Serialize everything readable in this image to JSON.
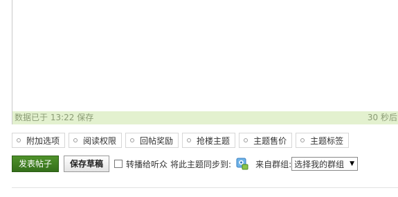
{
  "editor": {
    "status_saved": "数据已于 13:22 保存",
    "status_countdown": "30 秒后"
  },
  "options": [
    {
      "label": "附加选项"
    },
    {
      "label": "阅读权限"
    },
    {
      "label": "回帖奖励"
    },
    {
      "label": "抢楼主题"
    },
    {
      "label": "主题售价"
    },
    {
      "label": "主题标签"
    }
  ],
  "actions": {
    "publish_label": "发表帖子",
    "draft_label": "保存草稿",
    "forward_label": "转播给听众",
    "sync_label": "将此主题同步到:",
    "group_from_label": "来自群组:",
    "group_select_value": "选择我的群组",
    "forward_checked": false
  },
  "colors": {
    "status_bar_bg": "#e3f1cf",
    "publish_button_bg": "#3b7a1f"
  },
  "icons": {
    "option_bullet": "circle-bullet-icon",
    "sync": "qzone-sync-icon",
    "select_arrow": "caret-down-icon"
  }
}
